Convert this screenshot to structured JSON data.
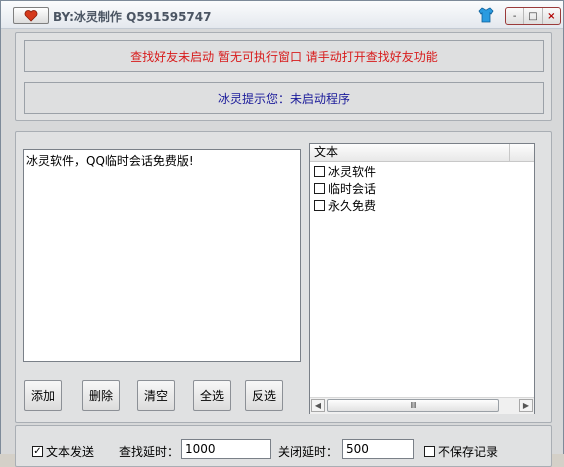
{
  "window": {
    "title": "BY:冰灵制作 Q591595747",
    "controls": {
      "minimize": "-",
      "maximize": "□",
      "close": "×"
    }
  },
  "messages": {
    "status_line": "查找好友未启动  暂无可执行窗口  请手动打开查找好友功能",
    "hint_line": "冰灵提示您：未启动程序",
    "status_color": "#d81b1b",
    "hint_color": "#1b1b9a"
  },
  "editor": {
    "text": "冰灵软件，QQ临时会话免费版!"
  },
  "buttons": {
    "add": "添加",
    "delete": "删除",
    "clear": "清空",
    "select_all": "全选",
    "invert": "反选"
  },
  "list": {
    "column_header": "文本",
    "items": [
      {
        "label": "冰灵软件",
        "checked": false
      },
      {
        "label": "临时会话",
        "checked": false
      },
      {
        "label": "永久免费",
        "checked": false
      }
    ],
    "scroll_left": "◀",
    "scroll_right": "▶",
    "scroll_grip": "IIII"
  },
  "settings": {
    "text_send_label": "文本发送",
    "text_send_checked": true,
    "find_delay_label": "查找延时：",
    "find_delay_value": "1000",
    "close_delay_label": "关闭延时：",
    "close_delay_value": "500",
    "no_save_label": "不保存记录",
    "no_save_checked": false
  },
  "icons": [
    "heart-icon",
    "tshirt-icon",
    "minimize-icon",
    "maximize-icon",
    "close-icon",
    "checkbox-icon",
    "scroll-left-icon",
    "scroll-right-icon"
  ]
}
